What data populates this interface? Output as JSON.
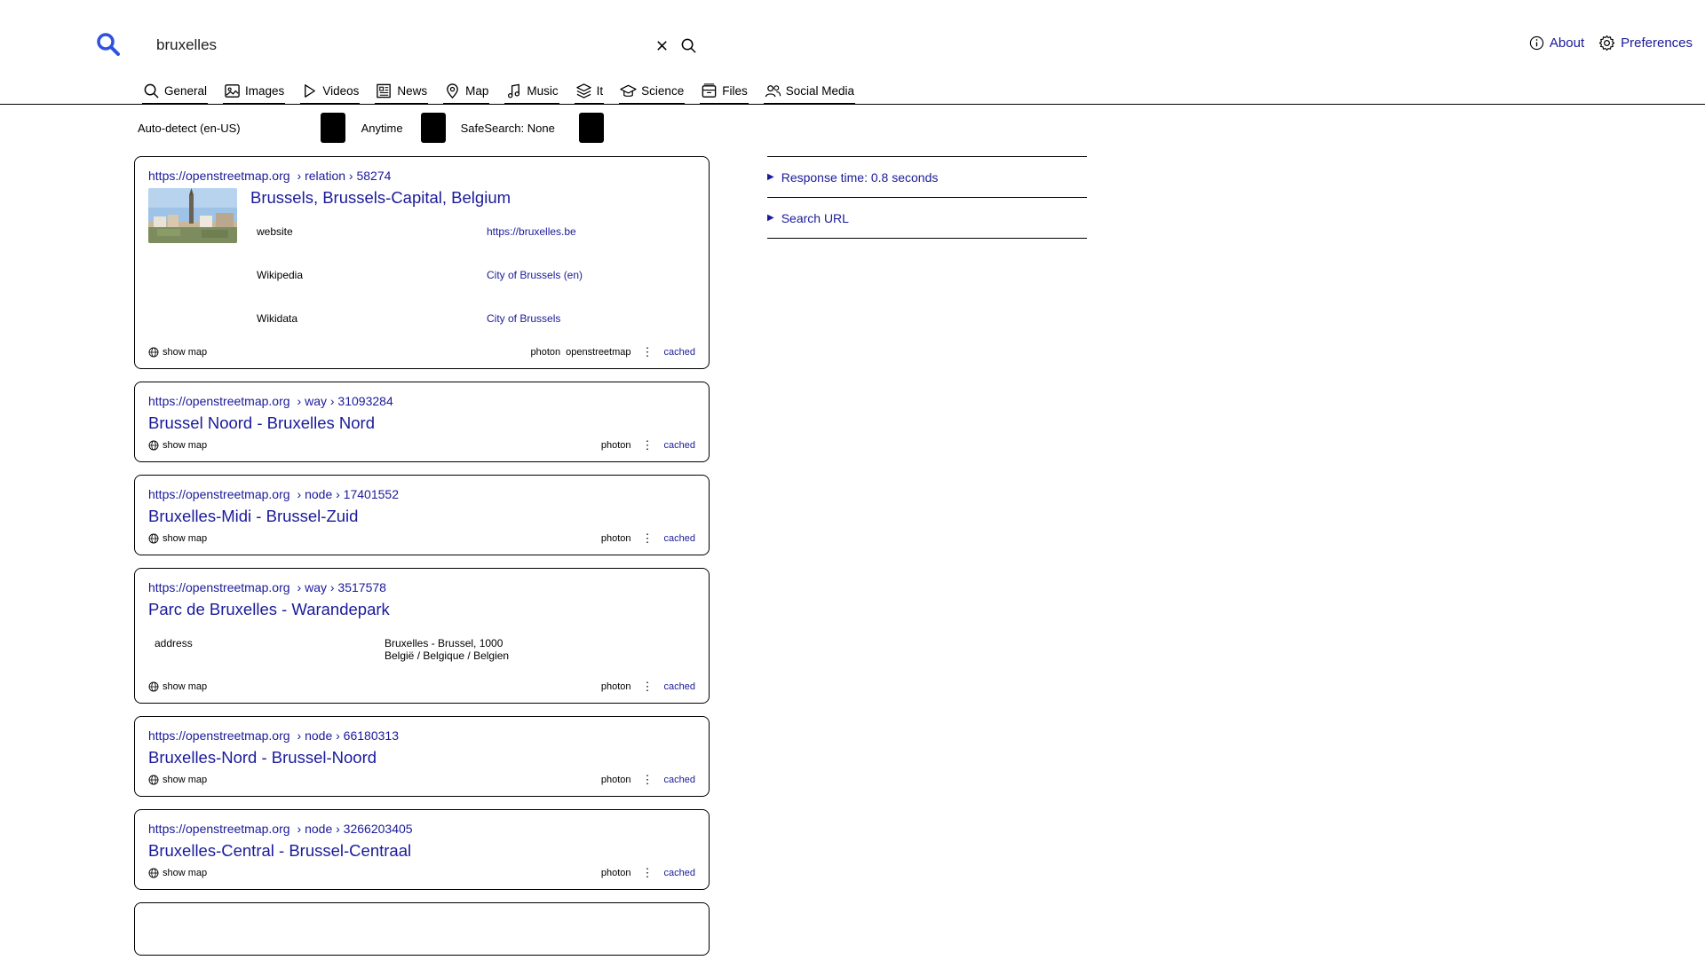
{
  "search": {
    "query": "bruxelles",
    "placeholder": ""
  },
  "header": {
    "about_label": "About",
    "preferences_label": "Preferences"
  },
  "tabs": [
    {
      "label": "General",
      "icon": "search-icon"
    },
    {
      "label": "Images",
      "icon": "image-icon"
    },
    {
      "label": "Videos",
      "icon": "play-icon"
    },
    {
      "label": "News",
      "icon": "newspaper-icon"
    },
    {
      "label": "Map",
      "icon": "map-pin-icon"
    },
    {
      "label": "Music",
      "icon": "music-icon"
    },
    {
      "label": "It",
      "icon": "layers-icon"
    },
    {
      "label": "Science",
      "icon": "graduation-cap-icon"
    },
    {
      "label": "Files",
      "icon": "archive-icon"
    },
    {
      "label": "Social Media",
      "icon": "people-icon"
    }
  ],
  "filters": {
    "language": "Auto-detect (en-US)",
    "time": "Anytime",
    "safesearch": "SafeSearch: None"
  },
  "results": [
    {
      "domain": "https://openstreetmap.org",
      "path": "› relation › 58274",
      "title": "Brussels, Brussels-Capital, Belgium",
      "fields": [
        {
          "key": "website",
          "value": "https://bruxelles.be"
        },
        {
          "key": "Wikipedia",
          "value": "City of Brussels (en)"
        },
        {
          "key": "Wikidata",
          "value": "City of Brussels"
        }
      ],
      "show_map": "show map",
      "engines": [
        "photon",
        "openstreetmap"
      ],
      "cached": "cached"
    },
    {
      "domain": "https://openstreetmap.org",
      "path": "› way › 31093284",
      "title": "Brussel Noord - Bruxelles Nord",
      "show_map": "show map",
      "engines": [
        "photon"
      ],
      "cached": "cached"
    },
    {
      "domain": "https://openstreetmap.org",
      "path": "› node › 17401552",
      "title": "Bruxelles-Midi - Brussel-Zuid",
      "show_map": "show map",
      "engines": [
        "photon"
      ],
      "cached": "cached"
    },
    {
      "domain": "https://openstreetmap.org",
      "path": "› way › 3517578",
      "title": "Parc de Bruxelles - Warandepark",
      "address_key": "address",
      "address_line1": "Bruxelles - Brussel, 1000",
      "address_line2": "België / Belgique / Belgien",
      "show_map": "show map",
      "engines": [
        "photon"
      ],
      "cached": "cached"
    },
    {
      "domain": "https://openstreetmap.org",
      "path": "› node › 66180313",
      "title": "Bruxelles-Nord - Brussel-Noord",
      "show_map": "show map",
      "engines": [
        "photon"
      ],
      "cached": "cached"
    },
    {
      "domain": "https://openstreetmap.org",
      "path": "› node › 3266203405",
      "title": "Bruxelles-Central - Brussel-Centraal",
      "show_map": "show map",
      "engines": [
        "photon"
      ],
      "cached": "cached"
    }
  ],
  "sidebar": {
    "response_time": "Response time: 0.8 seconds",
    "search_url": "Search URL"
  },
  "colors": {
    "link": "#1a1a9a",
    "logo": "#3050e0"
  }
}
